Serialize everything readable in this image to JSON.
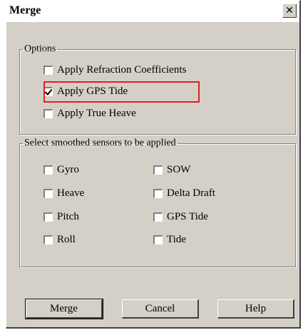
{
  "dialog": {
    "title": "Merge",
    "close_glyph": "✕"
  },
  "options": {
    "legend": "Options",
    "items": [
      {
        "label": "Apply Refraction Coefficients",
        "checked": false
      },
      {
        "label": "Apply GPS Tide",
        "checked": true,
        "highlighted": true
      },
      {
        "label": "Apply True Heave",
        "checked": false
      }
    ]
  },
  "sensors": {
    "legend": "Select smoothed sensors to be applied",
    "left_column": [
      {
        "label": "Gyro",
        "checked": false
      },
      {
        "label": "Heave",
        "checked": false
      },
      {
        "label": "Pitch",
        "checked": false
      },
      {
        "label": "Roll",
        "checked": false
      }
    ],
    "right_column": [
      {
        "label": "SOW",
        "checked": false
      },
      {
        "label": "Delta Draft",
        "checked": false
      },
      {
        "label": "GPS Tide",
        "checked": false
      },
      {
        "label": "Tide",
        "checked": false
      }
    ]
  },
  "buttons": {
    "merge": "Merge",
    "cancel": "Cancel",
    "help": "Help"
  },
  "colors": {
    "dialog_face": "#d4d0c8",
    "highlight_box": "#e02020"
  }
}
